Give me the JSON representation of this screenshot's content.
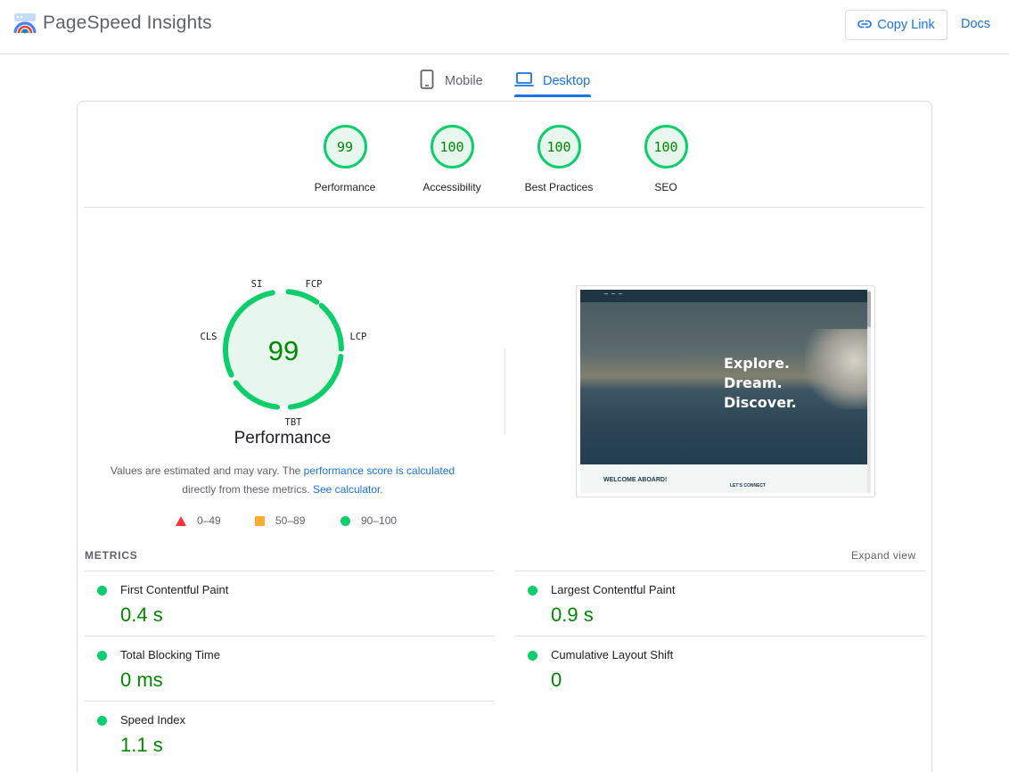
{
  "header": {
    "app_title": "PageSpeed Insights",
    "copy_link_label": "Copy Link",
    "docs_label": "Docs"
  },
  "tabs": [
    {
      "label": "Mobile",
      "icon": "smartphone-icon",
      "selected": false
    },
    {
      "label": "Desktop",
      "icon": "laptop-icon",
      "selected": true
    }
  ],
  "scores": [
    {
      "label": "Performance",
      "value": "99"
    },
    {
      "label": "Accessibility",
      "value": "100"
    },
    {
      "label": "Best Practices",
      "value": "100"
    },
    {
      "label": "SEO",
      "value": "100"
    }
  ],
  "performance": {
    "score": "99",
    "title": "Performance",
    "gauge_labels": {
      "si": "SI",
      "fcp": "FCP",
      "lcp": "LCP",
      "tbt": "TBT",
      "cls": "CLS"
    },
    "desc_text_1": "Values are estimated and may vary. The ",
    "desc_link_1": "performance score is calculated",
    "desc_text_2": " directly from these metrics. ",
    "desc_link_2": "See calculator."
  },
  "legend": [
    {
      "label": "0–49",
      "shape": "triangle",
      "color": "#ff3333"
    },
    {
      "label": "50–89",
      "shape": "square",
      "color": "#ffaa33"
    },
    {
      "label": "90–100",
      "shape": "circle",
      "color": "#0cce6b"
    }
  ],
  "screenshot": {
    "hero_text": "Explore.\nDream.\nDiscover.",
    "welcome_heading": "WELCOME ABOARD!",
    "connect_heading": "LET'S CONNECT"
  },
  "metrics": {
    "title": "METRICS",
    "expand_label": "Expand view",
    "items": [
      {
        "name": "First Contentful Paint",
        "value": "0.4 s"
      },
      {
        "name": "Largest Contentful Paint",
        "value": "0.9 s"
      },
      {
        "name": "Total Blocking Time",
        "value": "0 ms"
      },
      {
        "name": "Cumulative Layout Shift",
        "value": "0"
      },
      {
        "name": "Speed Index",
        "value": "1.1 s"
      }
    ]
  },
  "colors": {
    "accent": "#1a73e8",
    "pass": "#0cce6b",
    "pass_text": "#008800",
    "average": "#ffaa33",
    "fail": "#ff3333"
  }
}
